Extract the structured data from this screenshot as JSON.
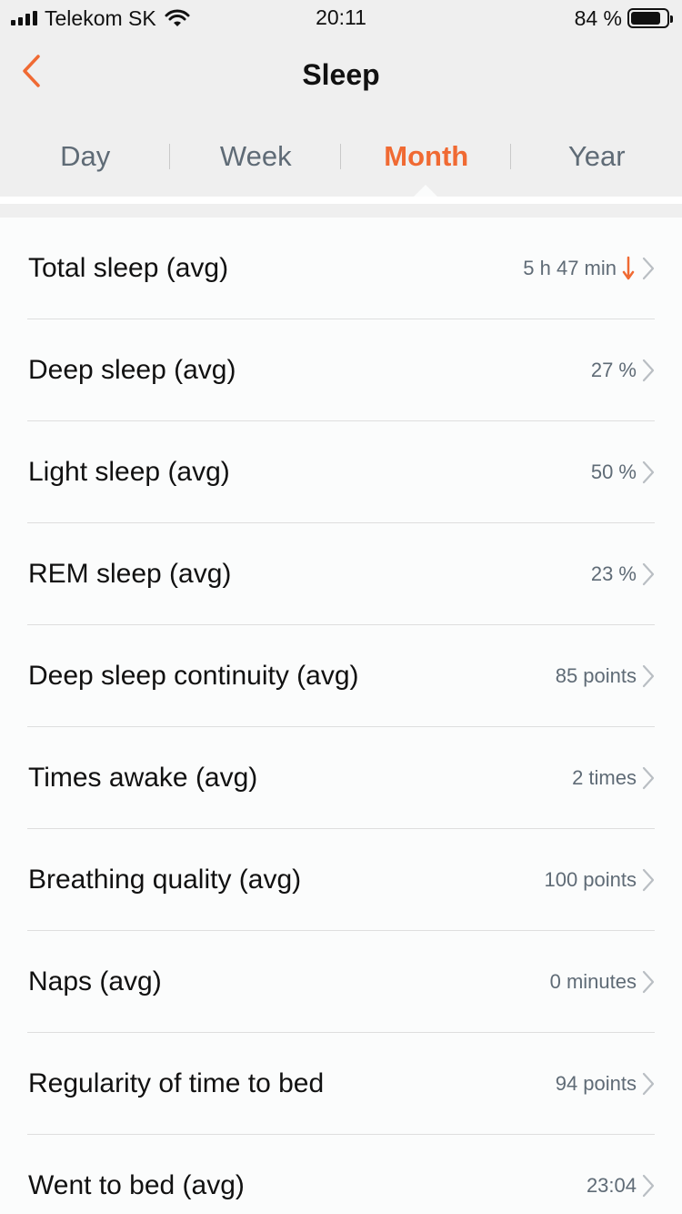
{
  "status_bar": {
    "carrier": "Telekom SK",
    "time": "20:11",
    "battery": "84 %",
    "battery_level": 0.84
  },
  "nav": {
    "title": "Sleep",
    "back_icon": "chevron-left-icon"
  },
  "tabs": [
    {
      "label": "Day",
      "active": false
    },
    {
      "label": "Week",
      "active": false
    },
    {
      "label": "Month",
      "active": true
    },
    {
      "label": "Year",
      "active": false
    }
  ],
  "colors": {
    "accent": "#f06a33",
    "secondary_text": "#5f6b76",
    "header_bg": "#efefef"
  },
  "list": [
    {
      "label": "Total sleep (avg)",
      "value": "5 h 47 min",
      "trend": "down"
    },
    {
      "label": "Deep sleep (avg)",
      "value": "27 %"
    },
    {
      "label": "Light sleep (avg)",
      "value": "50 %"
    },
    {
      "label": "REM sleep (avg)",
      "value": "23 %"
    },
    {
      "label": "Deep sleep continuity (avg)",
      "value": "85 points"
    },
    {
      "label": "Times awake (avg)",
      "value": "2 times"
    },
    {
      "label": "Breathing quality (avg)",
      "value": "100 points"
    },
    {
      "label": "Naps (avg)",
      "value": "0 minutes"
    },
    {
      "label": "Regularity of time to bed",
      "value": "94 points"
    },
    {
      "label": "Went to bed (avg)",
      "value": "23:04"
    }
  ]
}
